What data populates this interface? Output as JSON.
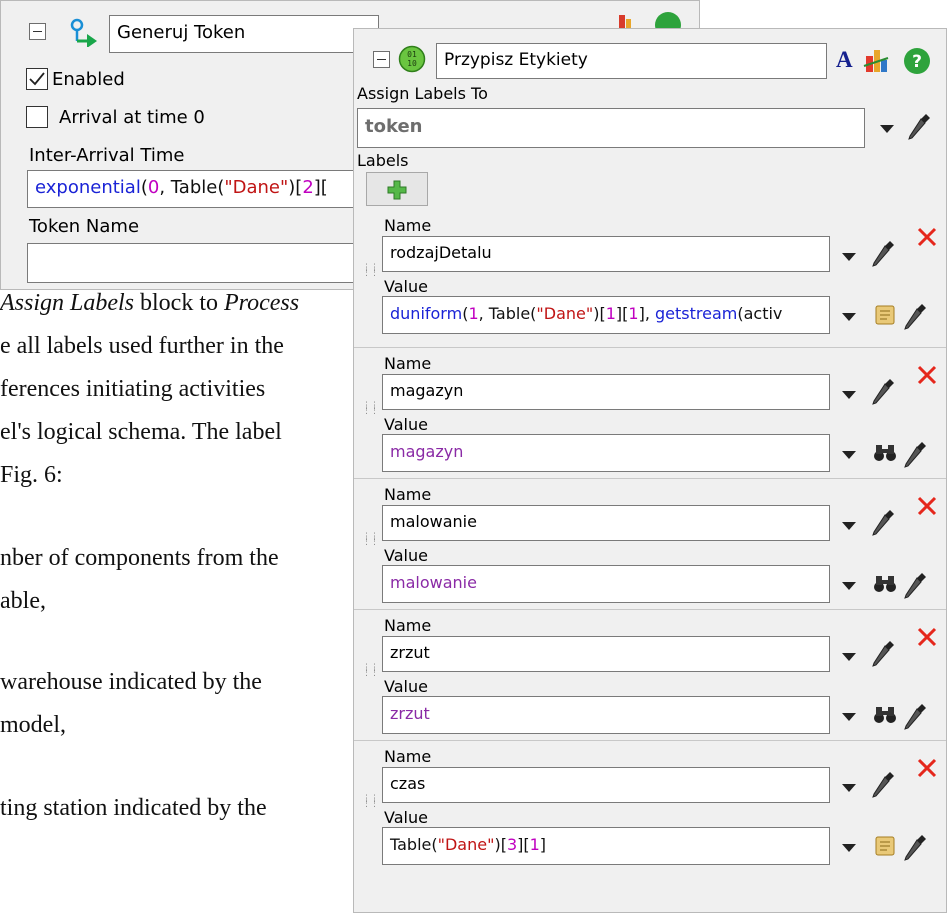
{
  "paper": {
    "lines": [
      {
        "pre": "",
        "italic": "Assign Labels",
        "mid": " block to ",
        "italic2": "Process",
        "post": ""
      },
      {
        "pre": "e all labels used further in the",
        "italic": "",
        "mid": "",
        "italic2": "",
        "post": ""
      },
      {
        "pre": "ferences  initiating  activities",
        "italic": "",
        "mid": "",
        "italic2": "",
        "post": ""
      },
      {
        "pre": "el's logical schema. The label",
        "italic": "",
        "mid": "",
        "italic2": "",
        "post": ""
      },
      {
        "pre": " Fig. 6:",
        "italic": "",
        "mid": "",
        "italic2": "",
        "post": ""
      },
      {
        "pre": "nber of components from the",
        "italic": "",
        "mid": "",
        "italic2": "",
        "post": ""
      },
      {
        "pre": "able,",
        "italic": "",
        "mid": "",
        "italic2": "",
        "post": ""
      },
      {
        "pre": "warehouse  indicated  by  the",
        "italic": "",
        "mid": "",
        "italic2": "",
        "post": ""
      },
      {
        "pre": " model,",
        "italic": "",
        "mid": "",
        "italic2": "",
        "post": ""
      },
      {
        "pre": "ting  station  indicated  by  the",
        "italic": "",
        "mid": "",
        "italic2": "",
        "post": ""
      }
    ]
  },
  "left_panel": {
    "title": "Generuj Token",
    "enabled_label": "Enabled",
    "enabled_checked": true,
    "arrival_label": "Arrival at time 0",
    "arrival_checked": false,
    "inter_arrival_label": "Inter-Arrival Time",
    "inter_arrival_code": [
      {
        "t": "exponential",
        "c": "kw"
      },
      {
        "t": "(",
        "c": "plain"
      },
      {
        "t": "0",
        "c": "num"
      },
      {
        "t": ", Table(",
        "c": "plain"
      },
      {
        "t": "\"Dane\"",
        "c": "str"
      },
      {
        "t": ")[",
        "c": "plain"
      },
      {
        "t": "2",
        "c": "num"
      },
      {
        "t": "][",
        "c": "plain"
      }
    ],
    "token_name_label": "Token Name",
    "token_name_value": ""
  },
  "right_panel": {
    "title": "Przypisz Etykiety",
    "font_button": "A",
    "assign_to_label": "Assign Labels To",
    "assign_to_value": "token",
    "labels_heading": "Labels",
    "name_label": "Name",
    "value_label": "Value",
    "entries": [
      {
        "name": "rodzajDetalu",
        "value_icon": "script-icon",
        "value_code": [
          {
            "t": "duniform",
            "c": "kw"
          },
          {
            "t": "(",
            "c": "plain"
          },
          {
            "t": "1",
            "c": "num"
          },
          {
            "t": ", Table(",
            "c": "plain"
          },
          {
            "t": "\"Dane\"",
            "c": "str"
          },
          {
            "t": ")[",
            "c": "plain"
          },
          {
            "t": "1",
            "c": "num"
          },
          {
            "t": "][",
            "c": "plain"
          },
          {
            "t": "1",
            "c": "num"
          },
          {
            "t": "], ",
            "c": "plain"
          },
          {
            "t": "getstream",
            "c": "kw"
          },
          {
            "t": "(activ",
            "c": "plain"
          }
        ]
      },
      {
        "name": "magazyn",
        "value_icon": "binoculars-icon",
        "value_code": [
          {
            "t": "magazyn",
            "c": "var"
          }
        ]
      },
      {
        "name": "malowanie",
        "value_icon": "binoculars-icon",
        "value_code": [
          {
            "t": "malowanie",
            "c": "var"
          }
        ]
      },
      {
        "name": "zrzut",
        "value_icon": "binoculars-icon",
        "value_code": [
          {
            "t": "zrzut",
            "c": "var"
          }
        ]
      },
      {
        "name": "czas",
        "value_icon": "script-icon",
        "value_code": [
          {
            "t": "Table(",
            "c": "plain"
          },
          {
            "t": "\"Dane\"",
            "c": "str"
          },
          {
            "t": ")[",
            "c": "plain"
          },
          {
            "t": "3",
            "c": "num"
          },
          {
            "t": "][",
            "c": "plain"
          },
          {
            "t": "1",
            "c": "num"
          },
          {
            "t": "]",
            "c": "plain"
          }
        ]
      }
    ]
  },
  "colors": {
    "panel_bg": "#f0f0f0",
    "keyword": "#1a23d6",
    "number": "#c000c0",
    "string": "#c01414",
    "variable": "#8a2aa6",
    "delete_red": "#e5271c",
    "add_green": "#55b848"
  }
}
